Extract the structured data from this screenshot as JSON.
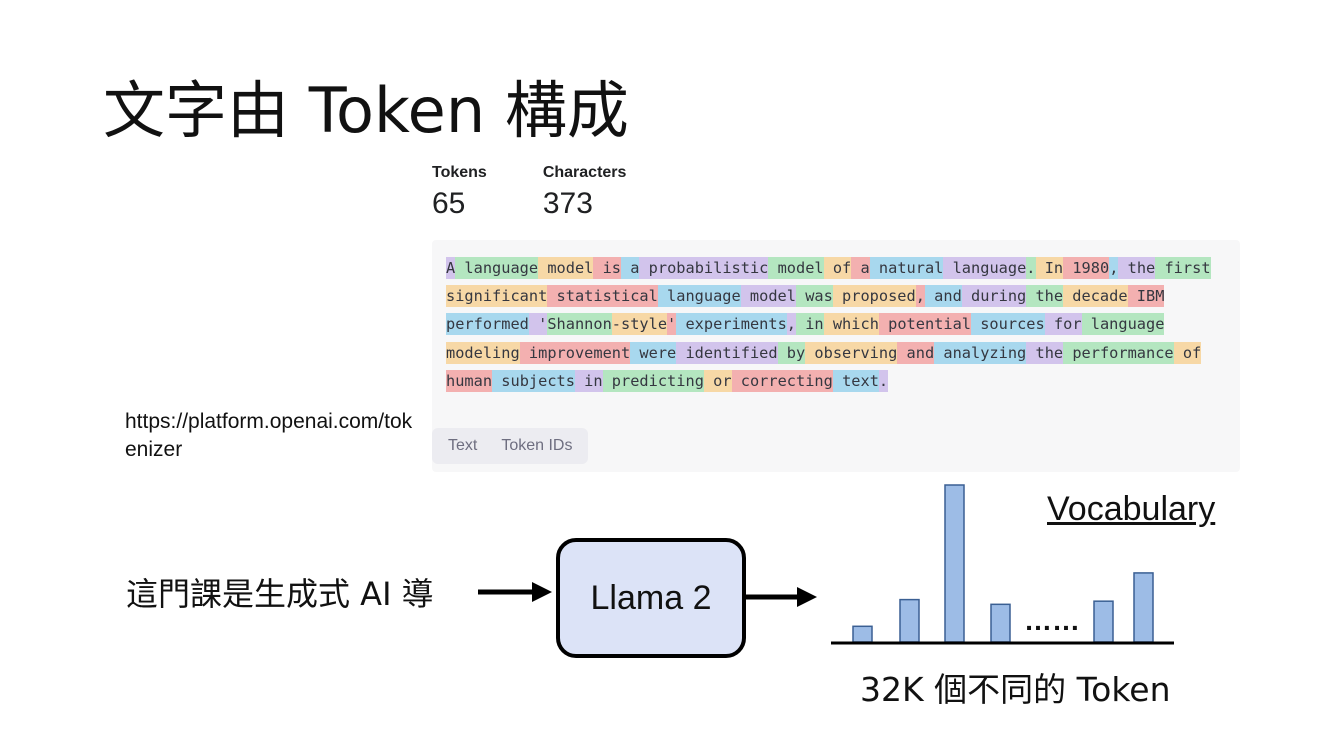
{
  "slide": {
    "title": "文字由 Token 構成",
    "url_caption": "https://platform.openai.com/tokenizer"
  },
  "tokenizer": {
    "tokens_label": "Tokens",
    "tokens_value": "65",
    "characters_label": "Characters",
    "characters_value": "373",
    "tokens": [
      "A",
      " language",
      " model",
      " is",
      " a",
      " probabilistic",
      " model",
      " of",
      " a",
      " natural",
      " language",
      ".",
      " In",
      " 1980",
      ",",
      " the",
      " first",
      " significant",
      " statistical",
      " language",
      " model",
      " was",
      " proposed",
      ",",
      " and",
      " during",
      " the",
      " decade",
      " IBM",
      " performed",
      " '",
      "Shannon",
      "-style",
      "'",
      " experiments",
      ",",
      " in",
      " which",
      " potential",
      " sources",
      " for",
      " language",
      " modeling",
      " improvement",
      " were",
      " identified",
      " by",
      " observing",
      " and",
      " analyzing",
      " the",
      " performance",
      " of",
      " human",
      " subjects",
      " in",
      " predicting",
      " or",
      " correcting",
      " text",
      "."
    ],
    "tabs": [
      "Text",
      "Token IDs"
    ]
  },
  "diagram": {
    "input_text": "這門課是生成式 AI 導",
    "model_label": "Llama 2",
    "vocab_title": "Vocabulary",
    "ellipsis": "……",
    "vocab_caption": "32K 個不同的 Token",
    "bar_color": "#9dbce6",
    "bars": [
      0.1,
      0.27,
      1.0,
      0.24,
      0.26,
      0.44
    ]
  }
}
